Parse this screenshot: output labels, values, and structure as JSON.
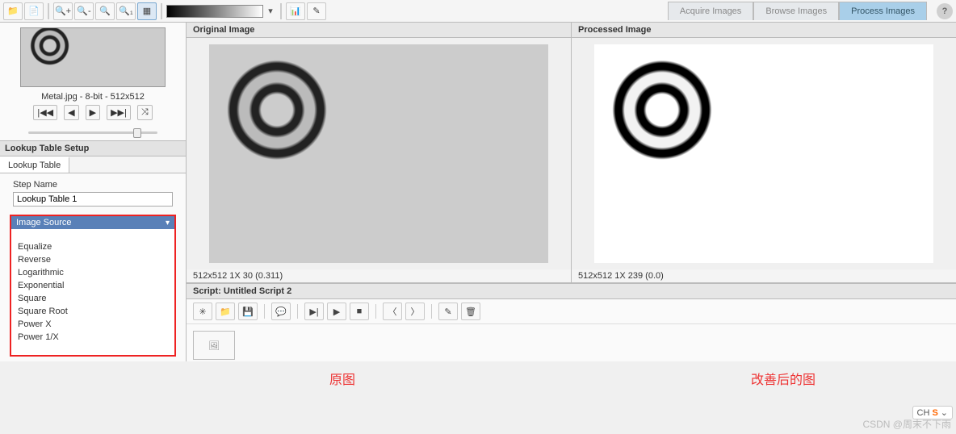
{
  "toolbar": {
    "open_title": "Open",
    "save_title": "Save",
    "zoom_in": "Zoom In",
    "zoom_out": "Zoom Out",
    "zoom_fit": "Zoom to Fit",
    "zoom_1_1": "Zoom 1:1",
    "select_tool": "Selection",
    "hist": "Histogram",
    "bright": "Brightness"
  },
  "nav": {
    "acquire": "Acquire Images",
    "browse": "Browse Images",
    "process": "Process Images"
  },
  "help": "?",
  "thumb": {
    "info": "Metal.jpg - 8-bit - 512x512",
    "first": "|◀◀",
    "prev": "◀",
    "play": "▶",
    "last": "▶▶|",
    "loop": "⤨"
  },
  "left": {
    "header": "Lookup Table Setup",
    "subtab": "Lookup Table",
    "step_label": "Step Name",
    "step_value": "Lookup Table 1",
    "list_header": "Image Source",
    "items": [
      "Equalize",
      "Reverse",
      "Logarithmic",
      "Exponential",
      "Square",
      "Square Root",
      "Power X",
      "Power 1/X"
    ]
  },
  "panels": {
    "original": "Original Image",
    "processed": "Processed Image",
    "orig_status": "512x512 1X 30  (0.311)",
    "proc_status": "512x512 1X 239   (0.0)"
  },
  "script": {
    "header": "Script: Untitled Script 2"
  },
  "annot": {
    "left": "原图",
    "right": "改善后的图"
  },
  "ime": {
    "ch": "CH",
    "dn": "⌄"
  },
  "orange_s": "S",
  "watermark": "CSDN @周末不下雨"
}
